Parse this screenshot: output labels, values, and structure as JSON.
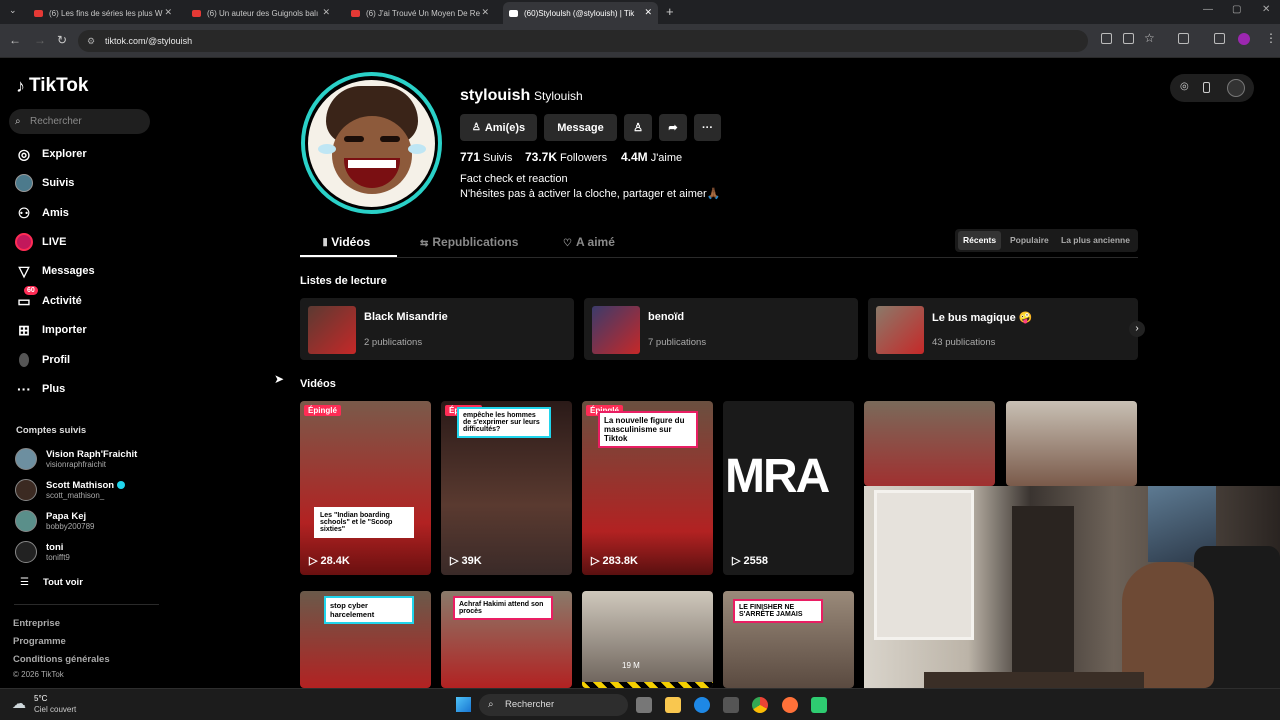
{
  "browser": {
    "tabs": [
      {
        "title": "(6) Les fins de séries les plus W",
        "active": false
      },
      {
        "title": "(6) Un auteur des Guignols balı",
        "active": false
      },
      {
        "title": "(6) J'ai Trouvé Un Moyen De Re",
        "active": false
      },
      {
        "title": "(60)Styloulsh (@stylouish) | Tik",
        "active": true
      }
    ],
    "url": "tiktok.com/@stylouish"
  },
  "sidebar": {
    "logo": "TikTok",
    "search_placeholder": "Rechercher",
    "nav": [
      {
        "label": "Explorer",
        "icon": "compass-icon"
      },
      {
        "label": "Suivis",
        "icon": "following-avatar-icon"
      },
      {
        "label": "Amis",
        "icon": "friends-icon"
      },
      {
        "label": "LIVE",
        "icon": "live-icon"
      },
      {
        "label": "Messages",
        "icon": "paper-plane-icon"
      },
      {
        "label": "Activité",
        "icon": "inbox-icon",
        "badge": "60"
      },
      {
        "label": "Importer",
        "icon": "plus-square-icon"
      },
      {
        "label": "Profil",
        "icon": "profile-icon"
      },
      {
        "label": "Plus",
        "icon": "more-dots-icon"
      }
    ],
    "following_title": "Comptes suivis",
    "following": [
      {
        "name": "Vision Raph'Fraichit",
        "handle": "visionraphfraichit"
      },
      {
        "name": "Scott Mathison",
        "handle": "scott_mathison_",
        "verified": true
      },
      {
        "name": "Papa Kej",
        "handle": "bobby200789"
      },
      {
        "name": "toni",
        "handle": "tonifft9"
      }
    ],
    "see_all": "Tout voir",
    "footer": [
      "Entreprise",
      "Programme",
      "Conditions générales"
    ],
    "copyright": "© 2026 TikTok"
  },
  "profile": {
    "username": "stylouish",
    "display_name": "Stylouish",
    "buttons": {
      "friends": "Ami(e)s",
      "message": "Message"
    },
    "stats": [
      {
        "value": "771",
        "label": "Suivis"
      },
      {
        "value": "73.7K",
        "label": "Followers"
      },
      {
        "value": "4.4M",
        "label": "J'aime"
      }
    ],
    "bio_line1": "Fact check et reaction",
    "bio_line2": "N'hésites pas à activer la cloche, partager et aimer🙏🏾"
  },
  "tabs": [
    "Vidéos",
    "Republications",
    "A aimé"
  ],
  "sort": [
    "Récents",
    "Populaire",
    "La plus ancienne"
  ],
  "playlists": {
    "title": "Listes de lecture",
    "items": [
      {
        "name": "Black Misandrie",
        "count": "2 publications"
      },
      {
        "name": "benoïd",
        "count": "7 publications"
      },
      {
        "name": "Le bus magique 🤪",
        "count": "43 publications"
      }
    ]
  },
  "videos": {
    "title": "Vidéos",
    "pinned_label": "Épinglé",
    "row1": [
      {
        "views": "28.4K",
        "pinned": true,
        "caption": "Les \"Indian boarding schools\" et le \"Scoop sixties\""
      },
      {
        "views": "39K",
        "pinned": true,
        "caption": "empêche les hommes de s'exprimer sur leurs difficultés?"
      },
      {
        "views": "283.8K",
        "pinned": true,
        "caption": "La nouvelle figure du masculinisme sur Tiktok"
      },
      {
        "views": "2558",
        "pinned": false,
        "caption": "MRA"
      },
      {
        "views": "",
        "pinned": false,
        "caption": ""
      },
      {
        "views": "",
        "pinned": false,
        "caption": ""
      }
    ],
    "row2": [
      {
        "caption": "stop cyber harcelement"
      },
      {
        "caption": "Achraf Hakimi attend son procès"
      },
      {
        "caption": "19 M"
      },
      {
        "caption": "LE FINISHER NE S'ARRÊTE JAMAIS"
      }
    ]
  },
  "taskbar": {
    "weather_temp": "5°C",
    "weather_desc": "Ciel couvert",
    "search_placeholder": "Rechercher"
  }
}
